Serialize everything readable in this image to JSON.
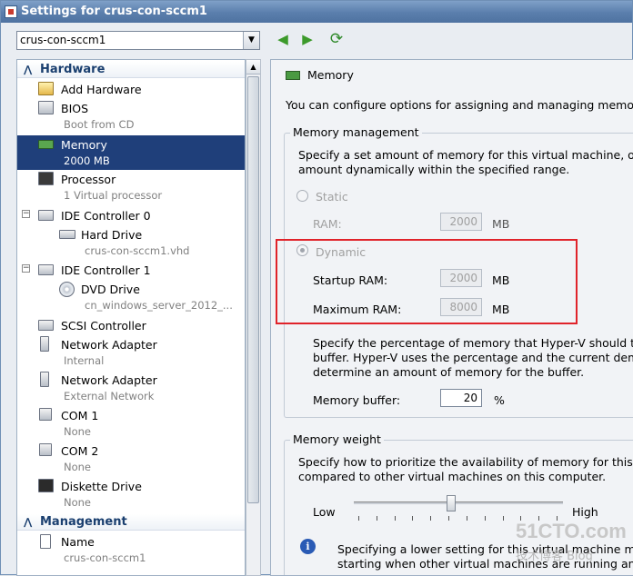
{
  "window": {
    "title": "Settings for crus-con-sccm1"
  },
  "vm_selector": {
    "value": "crus-con-sccm1"
  },
  "sidebar": {
    "hardware_header": "Hardware",
    "management_header": "Management",
    "items": [
      {
        "label": "Add Hardware",
        "sub": ""
      },
      {
        "label": "BIOS",
        "sub": "Boot from CD"
      },
      {
        "label": "Memory",
        "sub": "2000 MB"
      },
      {
        "label": "Processor",
        "sub": "1 Virtual processor"
      },
      {
        "label": "IDE Controller 0",
        "sub": ""
      },
      {
        "label": "Hard Drive",
        "sub": "crus-con-sccm1.vhd"
      },
      {
        "label": "IDE Controller 1",
        "sub": ""
      },
      {
        "label": "DVD Drive",
        "sub": "cn_windows_server_2012_..."
      },
      {
        "label": "SCSI Controller",
        "sub": ""
      },
      {
        "label": "Network Adapter",
        "sub": "Internal"
      },
      {
        "label": "Network Adapter",
        "sub": "External Network"
      },
      {
        "label": "COM 1",
        "sub": "None"
      },
      {
        "label": "COM 2",
        "sub": "None"
      },
      {
        "label": "Diskette Drive",
        "sub": "None"
      }
    ],
    "management_items": [
      {
        "label": "Name",
        "sub": "crus-con-sccm1"
      }
    ]
  },
  "memory": {
    "title": "Memory",
    "intro": "You can configure options for assigning and managing memory for",
    "management": {
      "title": "Memory management",
      "desc_line1": "Specify a set amount of memory for this virtual machine, or let H",
      "desc_line2": "amount dynamically within the specified range.",
      "static_label": "Static",
      "ram_label": "RAM:",
      "ram_value": "2000",
      "dynamic_label": "Dynamic",
      "startup_label": "Startup RAM:",
      "startup_value": "2000",
      "max_label": "Maximum RAM:",
      "max_value": "8000",
      "unit": "MB",
      "buffer_desc_line1": "Specify the percentage of memory that Hyper-V should try to",
      "buffer_desc_line2": "buffer. Hyper-V uses the percentage and the current demand",
      "buffer_desc_line3": "determine an amount of memory for the buffer.",
      "buffer_label": "Memory buffer:",
      "buffer_value": "20",
      "buffer_unit": "%"
    },
    "weight": {
      "title": "Memory weight",
      "desc_line1": "Specify how to prioritize the availability of memory for this virtua",
      "desc_line2": "compared to other virtual machines on this computer.",
      "low_label": "Low",
      "high_label": "High",
      "slider_level": 0.47,
      "info_line1": "Specifying a lower setting for this virtual machine might prev",
      "info_line2": "starting when other virtual machines are running and available"
    }
  },
  "watermark": {
    "line1": "51CTO.com",
    "line2": "技术博客 Blog"
  }
}
